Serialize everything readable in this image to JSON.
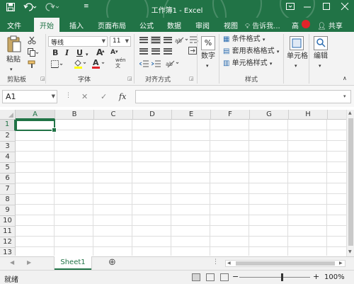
{
  "titlebar": {
    "title": "工作簿1 - Excel",
    "save_icon": "save-icon",
    "undo_icon": "undo-icon",
    "redo_icon": "redo-icon",
    "accent": "#217346"
  },
  "tabs": [
    "文件",
    "开始",
    "插入",
    "页面布局",
    "公式",
    "数据",
    "审阅",
    "视图"
  ],
  "tell_me": "告诉我...",
  "user": "高",
  "share": "共享",
  "ribbon": {
    "clipboard": {
      "paste": "粘贴",
      "label": "剪贴板"
    },
    "font": {
      "name": "等线",
      "size": "11",
      "bold": "B",
      "italic": "I",
      "underline": "U",
      "grow": "A",
      "shrink": "A",
      "font_color_letter": "A",
      "phonetic": "wén",
      "label": "字体"
    },
    "alignment": {
      "label": "对齐方式"
    },
    "number": {
      "button": "数字",
      "percent": "%"
    },
    "styles": {
      "conditional": "条件格式",
      "table": "套用表格格式",
      "cell_styles": "单元格样式",
      "label": "样式"
    },
    "cells": {
      "button": "单元格"
    },
    "editing": {
      "button": "编辑"
    }
  },
  "formula_bar": {
    "name_box": "A1",
    "fx": "fx",
    "cancel": "✕",
    "enter": "✓"
  },
  "columns": [
    "A",
    "B",
    "C",
    "D",
    "E",
    "F",
    "G",
    "H"
  ],
  "rows": [
    "1",
    "2",
    "3",
    "4",
    "5",
    "6",
    "7",
    "8",
    "9",
    "10",
    "11",
    "12",
    "13"
  ],
  "sheet_tab": "Sheet1",
  "add_sheet": "⊕",
  "status": "就绪",
  "zoom": "100%",
  "zoom_minus": "−",
  "zoom_plus": "+"
}
